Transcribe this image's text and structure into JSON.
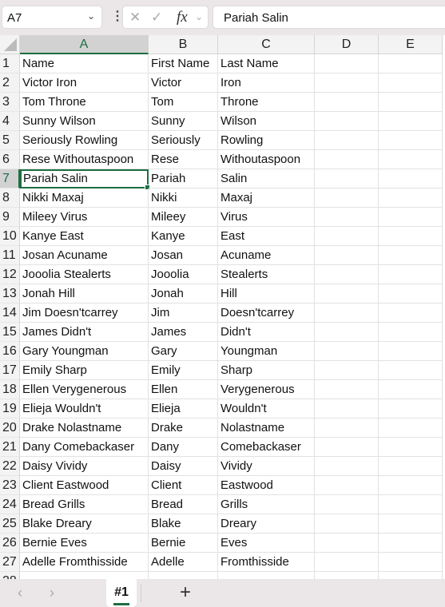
{
  "name_box": "A7",
  "formula": "Pariah Salin",
  "columns": [
    "A",
    "B",
    "C",
    "D",
    "E"
  ],
  "selected_cell": {
    "row": 7,
    "col": "A"
  },
  "rows": [
    [
      "Name",
      "First Name",
      "Last Name"
    ],
    [
      "Victor Iron",
      "Victor",
      "Iron"
    ],
    [
      "Tom Throne",
      "Tom",
      "Throne"
    ],
    [
      "Sunny Wilson",
      "Sunny",
      "Wilson"
    ],
    [
      "Seriously Rowling",
      "Seriously",
      "Rowling"
    ],
    [
      "Rese Withoutaspoon",
      "Rese",
      "Withoutaspoon"
    ],
    [
      "Pariah Salin",
      "Pariah",
      "Salin"
    ],
    [
      "Nikki Maxaj",
      "Nikki",
      "Maxaj"
    ],
    [
      "Mileey Virus",
      "Mileey",
      "Virus"
    ],
    [
      "Kanye East",
      "Kanye",
      "East"
    ],
    [
      "Josan Acuname",
      "Josan",
      "Acuname"
    ],
    [
      "Jooolia Stealerts",
      "Jooolia",
      "Stealerts"
    ],
    [
      "Jonah Hill",
      "Jonah",
      "Hill"
    ],
    [
      "Jim Doesn'tcarrey",
      "Jim",
      "Doesn'tcarrey"
    ],
    [
      "James Didn't",
      "James",
      "Didn't"
    ],
    [
      "Gary Youngman",
      "Gary",
      "Youngman"
    ],
    [
      "Emily Sharp",
      "Emily",
      "Sharp"
    ],
    [
      "Ellen Verygenerous",
      "Ellen",
      "Verygenerous"
    ],
    [
      "Elieja Wouldn't",
      "Elieja",
      "Wouldn't"
    ],
    [
      "Drake Nolastname",
      "Drake",
      "Nolastname"
    ],
    [
      "Dany Comebackaser",
      "Dany",
      "Comebackaser"
    ],
    [
      "Daisy Vividy",
      "Daisy",
      "Vividy"
    ],
    [
      "Client Eastwood",
      "Client",
      "Eastwood"
    ],
    [
      "Bread Grills",
      "Bread",
      "Grills"
    ],
    [
      "Blake Dreary",
      "Blake",
      "Dreary"
    ],
    [
      "Bernie Eves",
      "Bernie",
      "Eves"
    ],
    [
      "Adelle Fromthisside",
      "Adelle",
      "Fromthisside"
    ]
  ],
  "sheet_tab": "#1",
  "icons": {
    "cancel": "✕",
    "enter": "✓",
    "fx": "fx",
    "add_sheet": "+"
  }
}
